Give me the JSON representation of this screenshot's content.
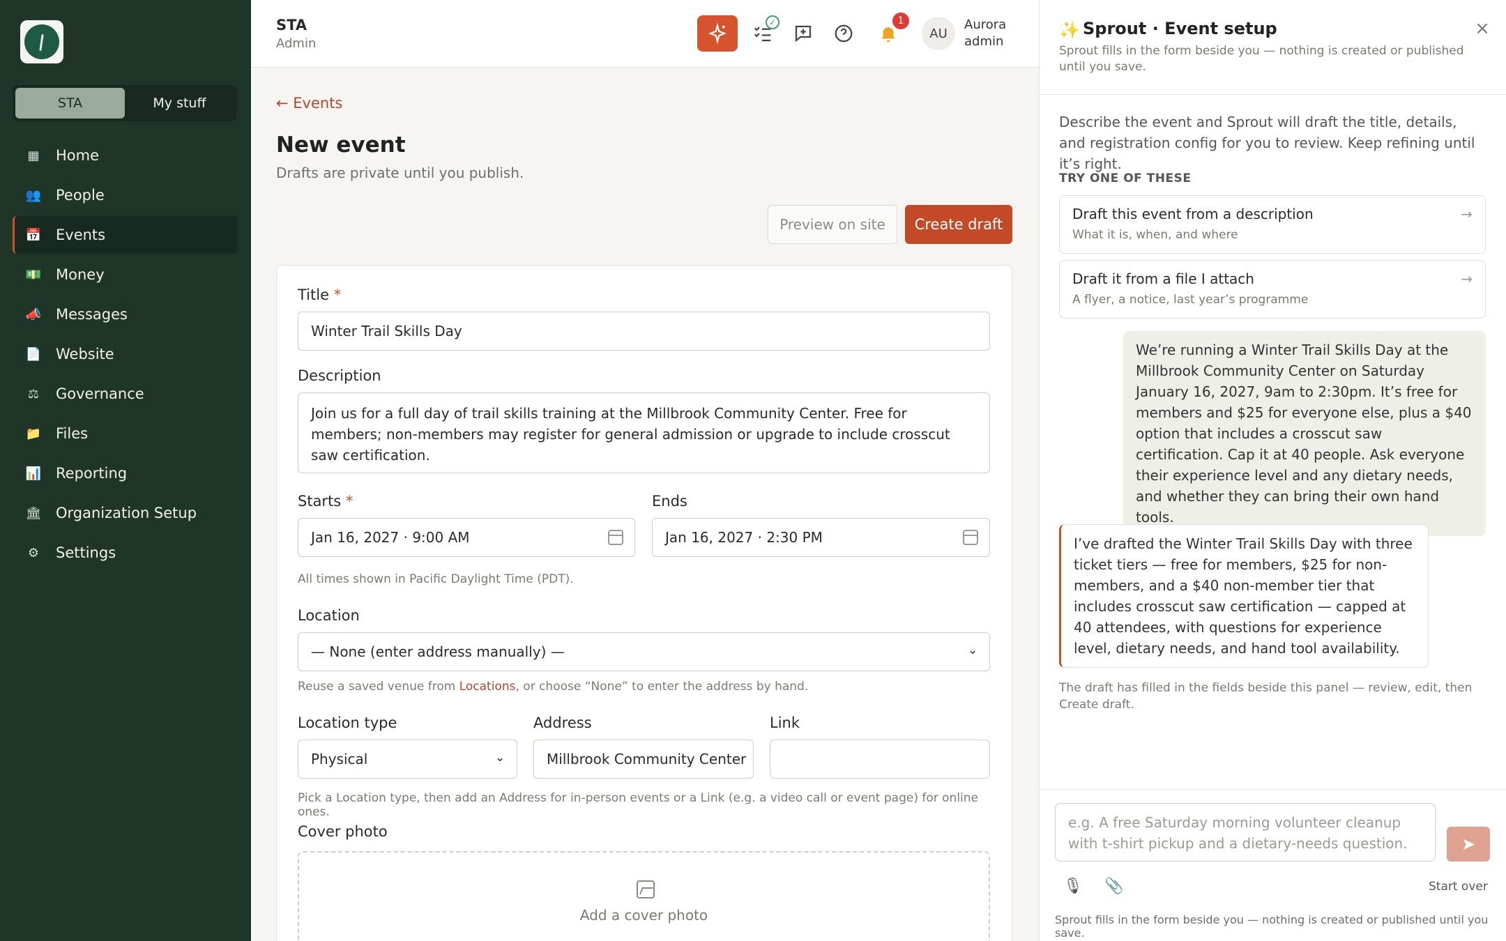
{
  "sidebar": {
    "switcher": {
      "org": "STA",
      "mine": "My stuff"
    },
    "items": [
      {
        "label": "Home",
        "icon": "home-grid-icon",
        "glyph": "▦"
      },
      {
        "label": "People",
        "icon": "people-icon",
        "glyph": "👥"
      },
      {
        "label": "Events",
        "icon": "calendar-icon",
        "glyph": "📅"
      },
      {
        "label": "Money",
        "icon": "money-icon",
        "glyph": "💵"
      },
      {
        "label": "Messages",
        "icon": "megaphone-icon",
        "glyph": "📣"
      },
      {
        "label": "Website",
        "icon": "page-icon",
        "glyph": "📄"
      },
      {
        "label": "Governance",
        "icon": "scales-icon",
        "glyph": "⚖"
      },
      {
        "label": "Files",
        "icon": "folder-icon",
        "glyph": "📁"
      },
      {
        "label": "Reporting",
        "icon": "chart-icon",
        "glyph": "📊"
      },
      {
        "label": "Organization Setup",
        "icon": "building-icon",
        "glyph": "🏛"
      },
      {
        "label": "Settings",
        "icon": "gear-icon",
        "glyph": "⚙"
      }
    ]
  },
  "topbar": {
    "org_name": "STA",
    "org_role": "Admin",
    "notification_count": "1",
    "avatar_initials": "AU",
    "user_name": "Aurora",
    "user_role": "admin"
  },
  "main": {
    "back_link": "← Events",
    "title": "New event",
    "subtitle": "Drafts are private until you publish.",
    "preview_button": "Preview on site",
    "create_button": "Create draft",
    "form": {
      "title_label": "Title",
      "required_mark": "*",
      "title_value": "Winter Trail Skills Day",
      "description_label": "Description",
      "description_value": "Join us for a full day of trail skills training at the Millbrook Community Center. Free for members; non-members may register for general admission or upgrade to include crosscut saw certification.",
      "starts_label": "Starts",
      "starts_value": "Jan 16, 2027 · 9:00 AM",
      "ends_label": "Ends",
      "ends_value": "Jan 16, 2027 · 2:30 PM",
      "timezone_help": "All times shown in Pacific Daylight Time (PDT).",
      "location_label": "Location",
      "location_value": "— None (enter address manually) —",
      "location_help_1": "Reuse a saved venue from ",
      "location_help_link": "Locations",
      "location_help_2": ", or choose “None” to enter the address by hand.",
      "location_type_label": "Location type",
      "location_type_value": "Physical",
      "address_label": "Address",
      "address_value": "Millbrook Community Center",
      "link_label": "Link",
      "link_value": "",
      "type_help": "Pick a Location type, then add an Address for in-person events or a Link (e.g. a video call or event page) for online ones.",
      "cover_label": "Cover photo",
      "cover_cta": "Add a cover photo"
    }
  },
  "panel": {
    "title": "Sprout · Event setup",
    "note": "Sprout fills in the form beside you — nothing is created or published until you save.",
    "intro": "Describe the event and Sprout will draft the title, details, and registration config for you to review. Keep refining until it’s right.",
    "try_label": "TRY ONE OF THESE",
    "suggestions": [
      {
        "title": "Draft this event from a description",
        "subtitle": "What it is, when, and where"
      },
      {
        "title": "Draft it from a file I attach",
        "subtitle": "A flyer, a notice, last year’s programme"
      }
    ],
    "user_message": "We’re running a Winter Trail Skills Day at the Millbrook Community Center on Saturday January 16, 2027, 9am to 2:30pm. It’s free for members and $25 for everyone else, plus a $40 option that includes a crosscut saw certification. Cap it at 40 people. Ask everyone their experience level and any dietary needs, and whether they can bring their own hand tools.",
    "bot_message": "I’ve drafted the Winter Trail Skills Day with three ticket tiers — free for members, $25 for non-members, and a $40 non-member tier that includes crosscut saw certification — capped at 40 attendees, with questions for experience level, dietary needs, and hand tool availability.",
    "after_note": "The draft has filled in the fields beside this panel — review, edit, then Create draft.",
    "composer_placeholder": "e.g. A free Saturday morning volunteer cleanup with t-shirt pickup and a dietary-needs question.",
    "start_over": "Start over",
    "footer_note": "Sprout fills in the form beside you — nothing is created or published until you save."
  }
}
